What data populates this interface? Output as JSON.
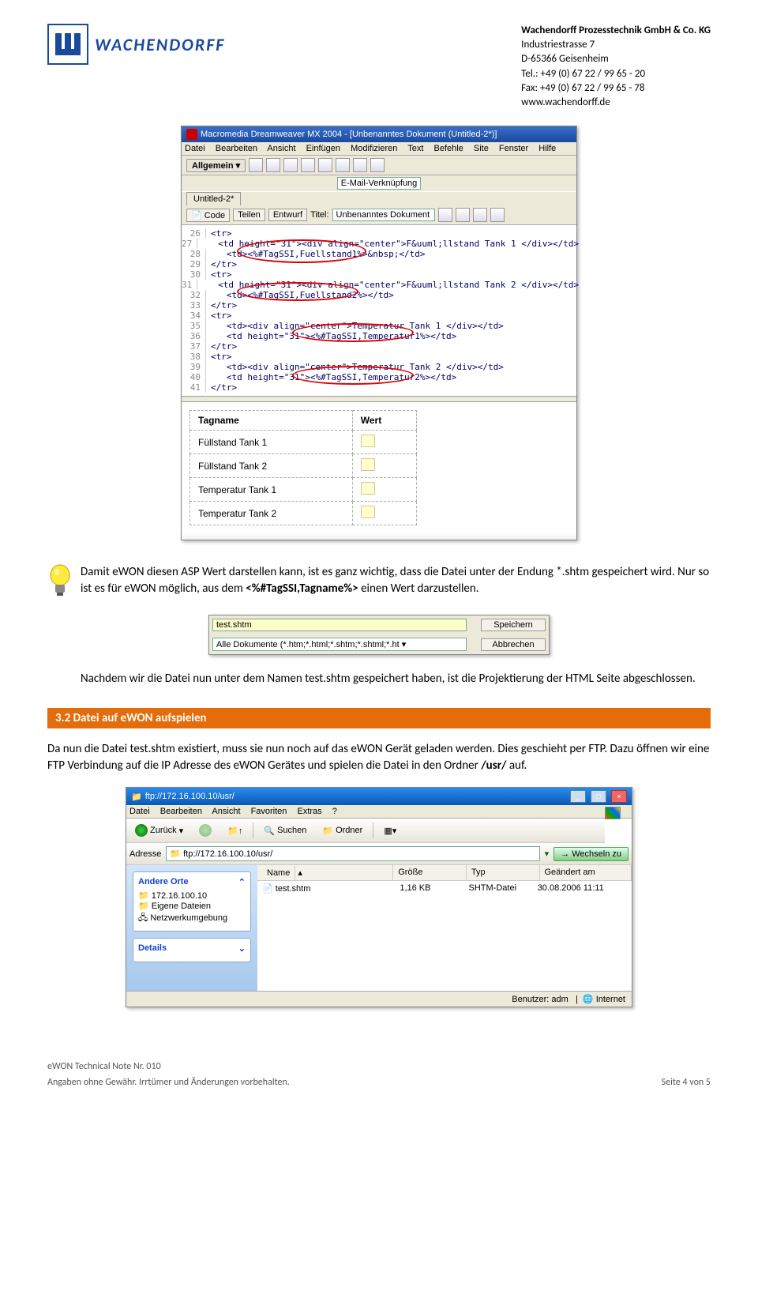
{
  "header": {
    "logoText": "WACHENDORFF",
    "company": "Wachendorff Prozesstechnik GmbH & Co. KG",
    "street": "Industriestrasse 7",
    "city": "D-65366 Geisenheim",
    "tel": "Tel.: +49 (0) 67 22 / 99 65 - 20",
    "fax": "Fax: +49 (0) 67 22 / 99 65 - 78",
    "web": "www.wachendorff.de"
  },
  "dw": {
    "title": "Macromedia Dreamweaver MX 2004 - [Unbenanntes Dokument (Untitled-2*)]",
    "menu": [
      "Datei",
      "Bearbeiten",
      "Ansicht",
      "Einfügen",
      "Modifizieren",
      "Text",
      "Befehle",
      "Site",
      "Fenster",
      "Hilfe"
    ],
    "general": "Allgemein  ▾",
    "emailLink": "E-Mail-Verknüpfung",
    "tab": "Untitled-2*",
    "viewButtons": {
      "code": "Code",
      "split": "Teilen",
      "design": "Entwurf"
    },
    "titleLabel": "Titel:",
    "titleValue": "Unbenanntes Dokument",
    "code": [
      {
        "n": "26",
        "t": "<tr>"
      },
      {
        "n": "27",
        "t": "   <td height=\"31\"><div align=\"center\">F&uuml;llstand Tank 1 </div></td>"
      },
      {
        "n": "28",
        "t": "   <td><%#TagSSI,Fuellstand1%>&nbsp;</td>"
      },
      {
        "n": "29",
        "t": "</tr>"
      },
      {
        "n": "30",
        "t": "<tr>"
      },
      {
        "n": "31",
        "t": "   <td height=\"31\"><div align=\"center\">F&uuml;llstand Tank 2 </div></td>"
      },
      {
        "n": "32",
        "t": "   <td><%#TagSSI,Fuellstand2%></td>"
      },
      {
        "n": "33",
        "t": "</tr>"
      },
      {
        "n": "34",
        "t": "<tr>"
      },
      {
        "n": "35",
        "t": "   <td><div align=\"center\">Temperatur Tank 1 </div></td>"
      },
      {
        "n": "36",
        "t": "   <td height=\"31\"><%#TagSSI,Temperatur1%></td>"
      },
      {
        "n": "37",
        "t": "</tr>"
      },
      {
        "n": "38",
        "t": "<tr>"
      },
      {
        "n": "39",
        "t": "   <td><div align=\"center\">Temperatur Tank 2 </div></td>"
      },
      {
        "n": "40",
        "t": "   <td height=\"31\"><%#TagSSI,Temperatur2%></td>"
      },
      {
        "n": "41",
        "t": "</tr>"
      }
    ],
    "preview": {
      "h1": "Tagname",
      "h2": "Wert",
      "rows": [
        "Füllstand Tank 1",
        "Füllstand Tank 2",
        "Temperatur Tank 1",
        "Temperatur Tank 2"
      ]
    }
  },
  "tip": {
    "p1a": "Damit eWON diesen ASP Wert darstellen kann, ist es ganz wichtig, dass die Datei unter der Endung *.shtm gespeichert wird. Nur so ist es für eWON möglich, aus dem ",
    "p1b": "<%#TagSSI,Tagname%>",
    "p1c": " einen Wert darzustellen."
  },
  "save": {
    "filename": "test.shtm",
    "filter": "Alle Dokumente (*.htm;*.html;*.shtm;*.shtml;*.ht",
    "saveBtn": "Speichern",
    "cancelBtn": "Abbrechen"
  },
  "p2": "Nachdem wir die Datei nun unter dem Namen test.shtm gespeichert haben, ist die Projektierung der HTML Seite abgeschlossen.",
  "section": "3.2 Datei auf eWON aufspielen",
  "p3a": "Da nun die Datei test.shtm existiert, muss sie nun noch auf das eWON Gerät geladen werden. Dies geschieht per FTP. Dazu öffnen wir eine FTP Verbindung auf die IP Adresse des eWON Gerätes und spielen die Datei in den Ordner ",
  "p3b": "/usr/",
  "p3c": " auf.",
  "ftp": {
    "title": "ftp://172.16.100.10/usr/",
    "menu": [
      "Datei",
      "Bearbeiten",
      "Ansicht",
      "Favoriten",
      "Extras",
      "?"
    ],
    "back": "Zurück",
    "search": "Suchen",
    "folders": "Ordner",
    "addrLabel": "Adresse",
    "addr": "ftp://172.16.100.10/usr/",
    "go": "Wechseln zu",
    "side1": "Andere Orte",
    "sideItems": [
      "172.16.100.10",
      "Eigene Dateien",
      "Netzwerkumgebung"
    ],
    "side2": "Details",
    "cols": {
      "name": "Name",
      "size": "Größe",
      "type": "Typ",
      "date": "Geändert am"
    },
    "file": {
      "name": "test.shtm",
      "size": "1,16 KB",
      "type": "SHTM-Datei",
      "date": "30.08.2006 11:11"
    },
    "user": "Benutzer: adm",
    "zone": "Internet"
  },
  "footer": {
    "l1": "eWON Technical Note Nr. 010",
    "l2": "Angaben ohne Gewähr. Irrtümer und Änderungen vorbehalten.",
    "r": "Seite 4 von 5"
  }
}
